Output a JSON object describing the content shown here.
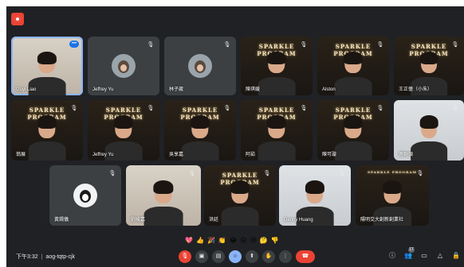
{
  "colors": {
    "background": "#202124",
    "tile": "#3c4043",
    "accent": "#8ab4f8",
    "danger": "#ea4335"
  },
  "banner_text": "SPARKLE PROGRAM",
  "participants": [
    {
      "name": "tzuyi Liao",
      "style": "room",
      "active": true,
      "more": true
    },
    {
      "name": "Jeffrey Yu",
      "style": "dark",
      "avatar": "photo"
    },
    {
      "name": "林子崴",
      "style": "dark",
      "avatar": "photo"
    },
    {
      "name": "陳琪媛",
      "style": "banner",
      "banner": true
    },
    {
      "name": "Alston",
      "style": "banner",
      "banner": true
    },
    {
      "name": "王正億（小朱）",
      "style": "banner",
      "banner": true
    },
    {
      "name": "翁展",
      "style": "banner",
      "banner": true
    },
    {
      "name": "Jeffrey Yu",
      "style": "banner",
      "banner": true
    },
    {
      "name": "吳享嘉",
      "style": "banner",
      "banner": true
    },
    {
      "name": "阿茹",
      "style": "banner",
      "banner": true
    },
    {
      "name": "陳可璇",
      "style": "banner",
      "banner": true
    },
    {
      "name": "傅群碩",
      "style": "light"
    },
    {
      "name": "黃錫儀",
      "style": "dark",
      "avatar": "cartoon"
    },
    {
      "name": "劉峻嘉",
      "style": "room"
    },
    {
      "name": "洪廷",
      "style": "banner",
      "banner": true
    },
    {
      "name": "Danny Huang",
      "style": "light"
    },
    {
      "name": "陽明交大創新創業社",
      "style": "banner",
      "banner_small": true
    }
  ],
  "reactions": [
    "💖",
    "👍",
    "🎉",
    "👏",
    "😂",
    "😮",
    "😢",
    "🤔",
    "👎"
  ],
  "meeting": {
    "time": "下午3:32",
    "separator": "|",
    "code": "aog-tqtp-cjk"
  },
  "controls": [
    "mic-off",
    "camera",
    "captions",
    "emoji",
    "present",
    "raise-hand",
    "more",
    "leave"
  ],
  "participant_count": "17"
}
